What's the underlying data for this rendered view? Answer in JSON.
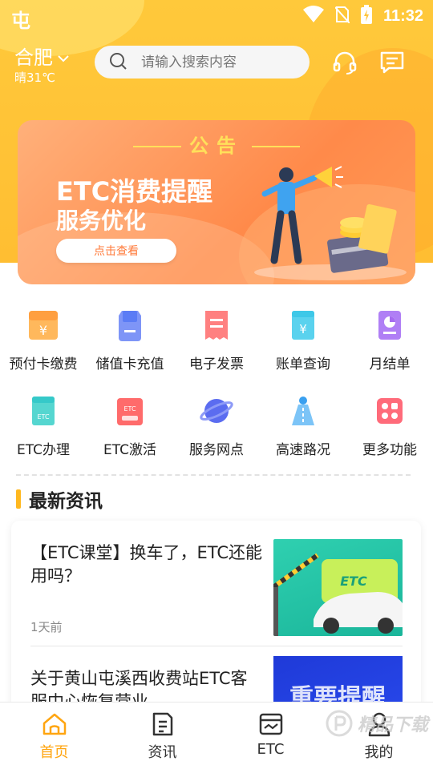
{
  "status": {
    "logo": "屯",
    "time": "11:32"
  },
  "header": {
    "city": "合肥",
    "weather": "晴31℃",
    "search_placeholder": "请输入搜索内容"
  },
  "banner": {
    "notice": "公告",
    "title": "ETC消费提醒",
    "subtitle": "服务优化",
    "button": "点击查看"
  },
  "services": [
    {
      "label": "预付卡缴费",
      "icon": "prepaid-card-icon",
      "color": "#ff9f40"
    },
    {
      "label": "储值卡充值",
      "icon": "stored-value-card-icon",
      "color": "#5b7cf5"
    },
    {
      "label": "电子发票",
      "icon": "e-invoice-icon",
      "color": "#ff6b6b"
    },
    {
      "label": "账单查询",
      "icon": "bill-query-icon",
      "color": "#3ec8e8"
    },
    {
      "label": "月结单",
      "icon": "monthly-statement-icon",
      "color": "#a66bf0"
    },
    {
      "label": "ETC办理",
      "icon": "etc-apply-icon",
      "color": "#35c9c9"
    },
    {
      "label": "ETC激活",
      "icon": "etc-activate-icon",
      "color": "#ff5a5a"
    },
    {
      "label": "服务网点",
      "icon": "service-outlet-icon",
      "color": "#5b6cf0"
    },
    {
      "label": "高速路况",
      "icon": "highway-traffic-icon",
      "color": "#3aa0f0"
    },
    {
      "label": "更多功能",
      "icon": "more-functions-icon",
      "color": "#ff5a6a"
    }
  ],
  "news": {
    "section_title": "最新资讯",
    "items": [
      {
        "headline": "【ETC课堂】换车了，ETC还能用吗？",
        "time": "1天前",
        "image_text": "ETC"
      },
      {
        "headline": "关于黄山屯溪西收费站ETC客服中心恢复营业…",
        "time": "",
        "image_text": "重要提醒"
      }
    ]
  },
  "bottom_nav": [
    {
      "label": "首页",
      "icon": "home-icon",
      "active": true
    },
    {
      "label": "资讯",
      "icon": "news-icon",
      "active": false
    },
    {
      "label": "ETC",
      "icon": "etc-card-icon",
      "active": false
    },
    {
      "label": "我的",
      "icon": "profile-icon",
      "active": false
    }
  ],
  "watermark": {
    "text": "精品下载"
  },
  "colors": {
    "accent": "#ffa510",
    "header_bg": "#ffc43a",
    "banner_bg": "#ff9a55"
  }
}
